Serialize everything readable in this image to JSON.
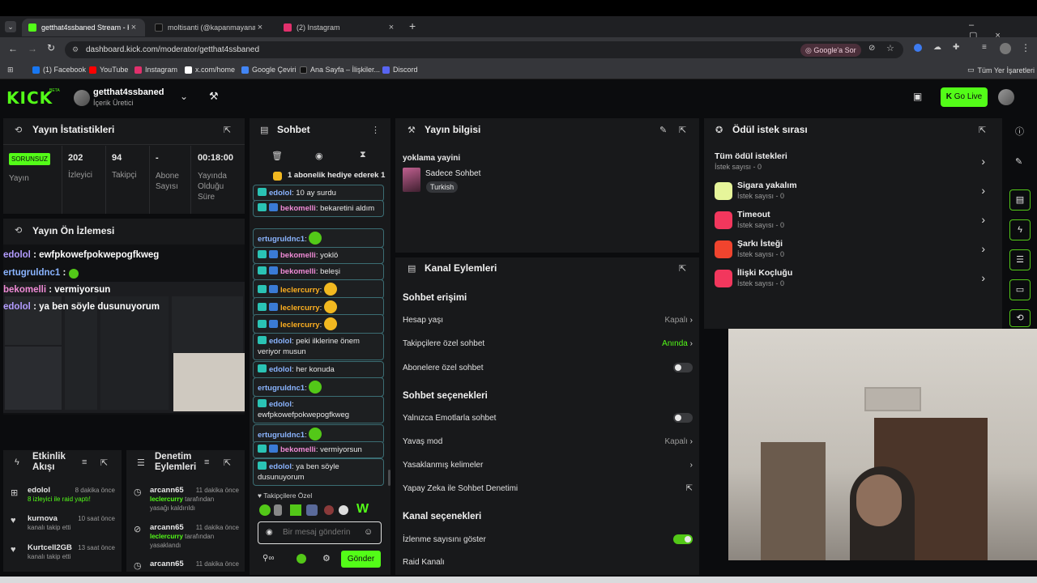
{
  "browser": {
    "tabs": [
      {
        "label": "getthat4ssbaned Stream - Kick",
        "active": true,
        "color": "#53fc18"
      },
      {
        "label": "moltisanti (@kapanmayanaray",
        "active": false,
        "color": "#111111"
      },
      {
        "label": "(2) Instagram",
        "active": false,
        "color": "#e1306c"
      }
    ],
    "url": "dashboard.kick.com/moderator/getthat4ssbaned",
    "ask_google": "Google'a Sor",
    "bookmarks": [
      "(1) Facebook",
      "YouTube",
      "Instagram",
      "x.com/home",
      "Google Çeviri",
      "Ana Sayfa – İlişkiler...",
      "Discord"
    ],
    "all_bookmarks": "Tüm Yer İşaretleri"
  },
  "header": {
    "logo": "KICK",
    "logo_beta": "BETA",
    "channel_name": "getthat4ssbaned",
    "role": "İçerik Üretici",
    "go_live": "Go Live"
  },
  "stats": {
    "title": "Yayın İstatistikleri",
    "status_badge": "SORUNSUZ",
    "status_label": "Yayın",
    "viewers_value": "202",
    "viewers_label": "İzleyici",
    "followers_value": "94",
    "followers_label": "Takipçi",
    "subs_value": "-",
    "subs_label_1": "Abone",
    "subs_label_2": "Sayısı",
    "uptime_value": "00:18:00",
    "uptime_label_1": "Yayında",
    "uptime_label_2": "Olduğu",
    "uptime_label_3": "Süre"
  },
  "preview": {
    "title": "Yayın Ön İzlemesi",
    "overlay": [
      {
        "user": "edolol",
        "text": " : ewfpkowefpokwepogfkweg"
      },
      {
        "user": "ertugruldnc1",
        "text": " : "
      },
      {
        "user": "bekomelli",
        "text": " : vermiyorsun"
      },
      {
        "user": "edolol",
        "text": " : ya ben söyle dusunuyorum"
      }
    ]
  },
  "activity": {
    "title_1": "Etkinlik",
    "title_2": "Akışı",
    "items": [
      {
        "user": "edolol",
        "time": "8 dakika önce",
        "desc": "8 izleyici ile raid yaptı!"
      },
      {
        "user": "kurnova",
        "time": "10 saat önce",
        "desc": "kanalı takip etti"
      },
      {
        "user": "Kurtcell2GB",
        "time": "13 saat önce",
        "desc": "kanalı takip etti"
      }
    ]
  },
  "moderation": {
    "title_1": "Denetim",
    "title_2": "Eylemleri",
    "items": [
      {
        "user": "arcann65",
        "time": "11 dakika önce",
        "target": "leclercurry",
        "desc_1": " tarafından",
        "desc_2": "yasağı kaldırıldı"
      },
      {
        "user": "arcann65",
        "time": "11 dakika önce",
        "target": "leclercurry",
        "desc_1": " tarafından",
        "desc_2": "yasaklandı"
      },
      {
        "user": "arcann65",
        "time": "11 dakika önce",
        "target": "",
        "desc_1": "",
        "desc_2": ""
      }
    ]
  },
  "chat": {
    "title": "Sohbet",
    "pinned": "1 abonelik hediye ederek 1",
    "messages": [
      {
        "user": "edolol",
        "text": ": 10 ay surdu",
        "color": "blue"
      },
      {
        "user": "bekomelli",
        "text": ": bekaretini aldım",
        "color": "pink"
      },
      {
        "user": "ertugruldnc1",
        "text": ":",
        "color": "blue"
      },
      {
        "user": "bekomelli",
        "text": ": yoklö",
        "color": "pink"
      },
      {
        "user": "bekomelli",
        "text": ": beleşi",
        "color": "pink"
      },
      {
        "user": "leclercurry",
        "text": ":",
        "color": "orange"
      },
      {
        "user": "leclercurry",
        "text": ":",
        "color": "orange"
      },
      {
        "user": "leclercurry",
        "text": ":",
        "color": "orange"
      },
      {
        "user": "edolol",
        "text": ": peki ilklerine önem veriyor musun",
        "color": "blue"
      },
      {
        "user": "edolol",
        "text": ": her konuda",
        "color": "blue"
      },
      {
        "user": "ertugruldnc1",
        "text": ":",
        "color": "blue"
      },
      {
        "user": "edolol",
        "text": ": ewfpkowefpokwepogfkweg",
        "color": "blue"
      },
      {
        "user": "ertugruldnc1",
        "text": ":",
        "color": "blue"
      },
      {
        "user": "bekomelli",
        "text": ": vermiyorsun",
        "color": "pink"
      },
      {
        "user": "edolol",
        "text": ": ya ben söyle dusunuyorum",
        "color": "blue"
      }
    ],
    "followers_only": "Takipçilere Özel",
    "input_placeholder": "Bir mesaj gönderin",
    "send": "Gönder"
  },
  "stream_info": {
    "title": "Yayın bilgisi",
    "stream_title": "yoklama yayini",
    "category": "Sadece Sohbet",
    "language": "Turkish"
  },
  "channel_actions": {
    "title": "Kanal Eylemleri",
    "sec_access": "Sohbet erişimi",
    "account_age": "Hesap yaşı",
    "account_age_value": "Kapalı",
    "followers_chat": "Takipçilere özel sohbet",
    "followers_chat_value": "Anında",
    "subs_chat": "Abonelere özel sohbet",
    "sec_options": "Sohbet seçenekleri",
    "emote_only": "Yalnızca Emotlarla sohbet",
    "slow_mode": "Yavaş mod",
    "slow_mode_value": "Kapalı",
    "banned_words": "Yasaklanmış kelimeler",
    "ai_moderation": "Yapay Zeka ile Sohbet Denetimi",
    "sec_channel": "Kanal seçenekleri",
    "show_viewcount": "İzlenme sayısını göster",
    "raid_channel": "Raid Kanalı"
  },
  "rewards": {
    "title": "Ödül istek sırası",
    "items": [
      {
        "name": "Tüm ödül istekleri",
        "sub": "İstek sayısı - 0",
        "color": ""
      },
      {
        "name": "Sigara yakalım",
        "sub": "İstek sayısı - 0",
        "color": "#e6f59a"
      },
      {
        "name": "Timeout",
        "sub": "İstek sayısı - 0",
        "color": "#f2375d"
      },
      {
        "name": "Şarkı İsteği",
        "sub": "İstek sayısı - 0",
        "color": "#f0442e"
      },
      {
        "name": "İlişki Koçluğu",
        "sub": "İstek sayısı - 0",
        "color": "#f2375d"
      }
    ]
  },
  "colors": {
    "accent": "#53fc18",
    "panel": "#18191b",
    "bg": "#0b0c0e"
  }
}
